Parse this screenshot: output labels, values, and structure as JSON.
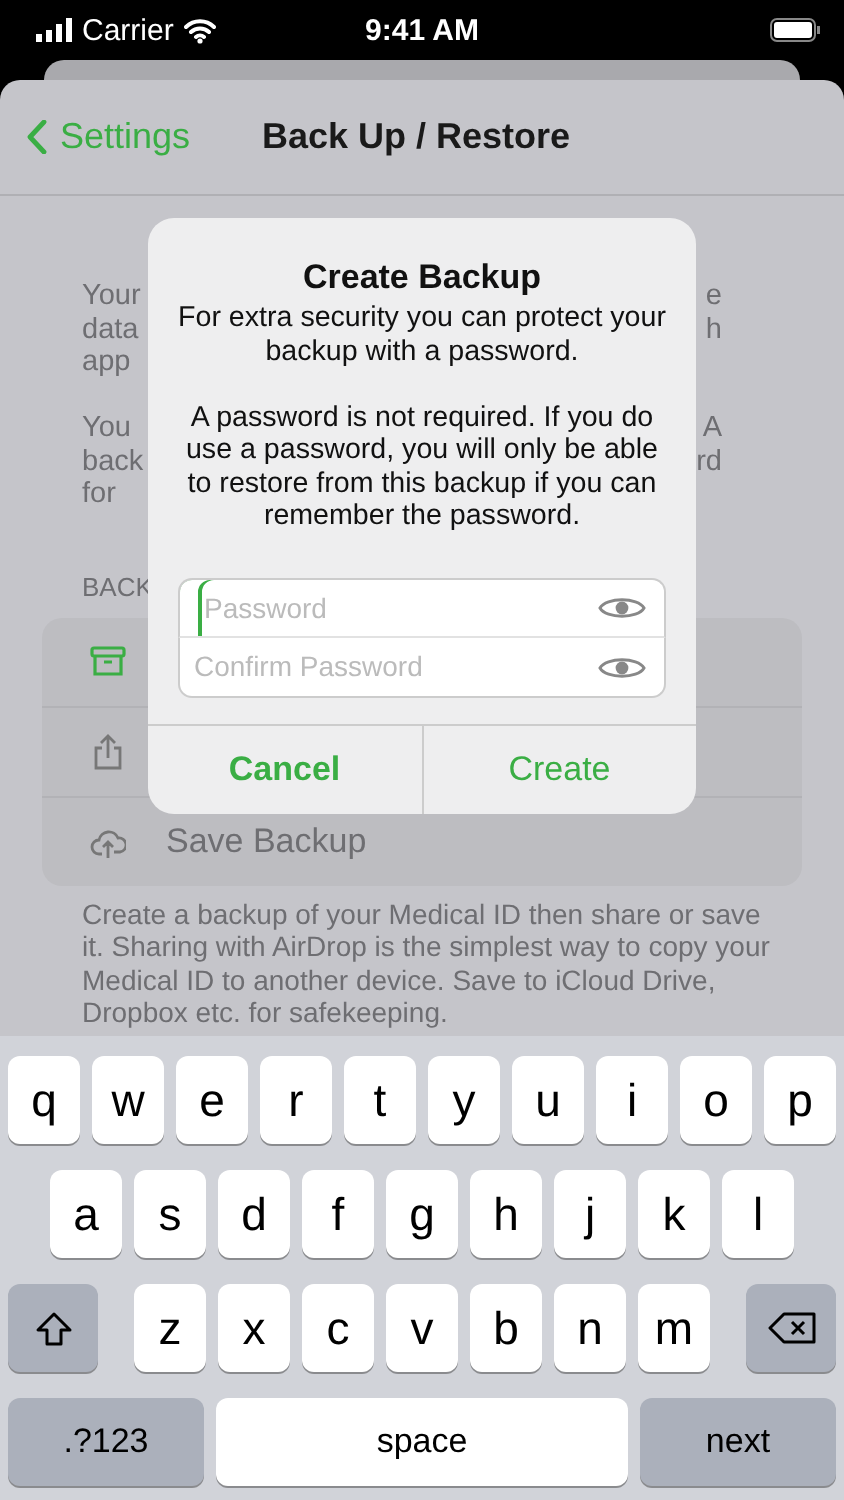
{
  "status_bar": {
    "carrier": "Carrier",
    "time": "9:41 AM"
  },
  "nav": {
    "back": "Settings",
    "title": "Back Up / Restore"
  },
  "background_paragraphs": [
    [
      {
        "left": "Your",
        "right": "e"
      },
      {
        "left": "data",
        "right": "h"
      },
      {
        "left": "app"
      }
    ],
    [
      {
        "left": "You",
        "right": "A"
      },
      {
        "left": "back",
        "right": "rd"
      },
      {
        "left": "for"
      }
    ]
  ],
  "section_header": "BACK",
  "list": [
    {
      "kind": "archive"
    },
    {
      "kind": "share"
    },
    {
      "kind": "cloud",
      "label": "Save Backup"
    }
  ],
  "footer": "Create a backup of your Medical ID then share or save it. Sharing with AirDrop is the simplest way to copy your Medical ID to another device. Save to iCloud Drive, Dropbox etc. for safekeeping.",
  "dialog": {
    "title": "Create Backup",
    "message": [
      "For extra security you can protect your backup with a password.",
      "A password is not required. If you do use a password, you will only be able to restore from this backup if you can remember the password."
    ],
    "fields": [
      {
        "placeholder": "Password",
        "focused": true
      },
      {
        "placeholder": "Confirm Password",
        "focused": false
      }
    ],
    "buttons": [
      {
        "label": "Cancel",
        "preferred": true
      },
      {
        "label": "Create",
        "preferred": false
      }
    ]
  },
  "keyboard": {
    "rows": [
      [
        "q",
        "w",
        "e",
        "r",
        "t",
        "y",
        "u",
        "i",
        "o",
        "p"
      ],
      [
        "a",
        "s",
        "d",
        "f",
        "g",
        "h",
        "j",
        "k",
        "l"
      ],
      [
        "z",
        "x",
        "c",
        "v",
        "b",
        "n",
        "m"
      ]
    ],
    "bottom": [
      {
        "kind": "mode",
        "label": ".?123"
      },
      {
        "kind": "space",
        "label": "space"
      },
      {
        "kind": "return",
        "label": "next"
      }
    ]
  }
}
